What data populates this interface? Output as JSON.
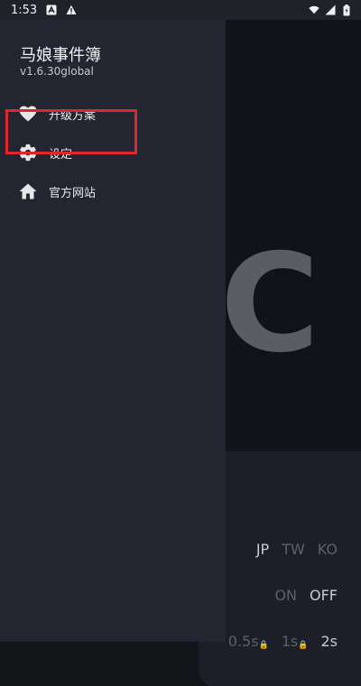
{
  "status_bar": {
    "time": "1:53",
    "icons": [
      "a-badge-icon",
      "alert-icon",
      "wifi-icon",
      "signal-icon",
      "battery-icon"
    ]
  },
  "drawer": {
    "app_name": "马娘事件簿",
    "version": "v1.6.30global",
    "items": [
      {
        "label": "升级方案",
        "icon": "heart-icon"
      },
      {
        "label": "设定",
        "icon": "gear-icon"
      },
      {
        "label": "官方网站",
        "icon": "home-icon"
      }
    ],
    "highlighted_item": "设定",
    "highlight_color": "#e0262d"
  },
  "background": {
    "glyph": "C",
    "languages": [
      "JP",
      "TW",
      "KO"
    ],
    "active_language": "JP",
    "toggle": [
      "ON",
      "OFF"
    ],
    "active_toggle": "OFF",
    "times": [
      "0.5s",
      "1s",
      "2s"
    ],
    "active_time": "2s"
  },
  "colors": {
    "drawer_bg": "#232630",
    "app_bg": "#101317"
  }
}
